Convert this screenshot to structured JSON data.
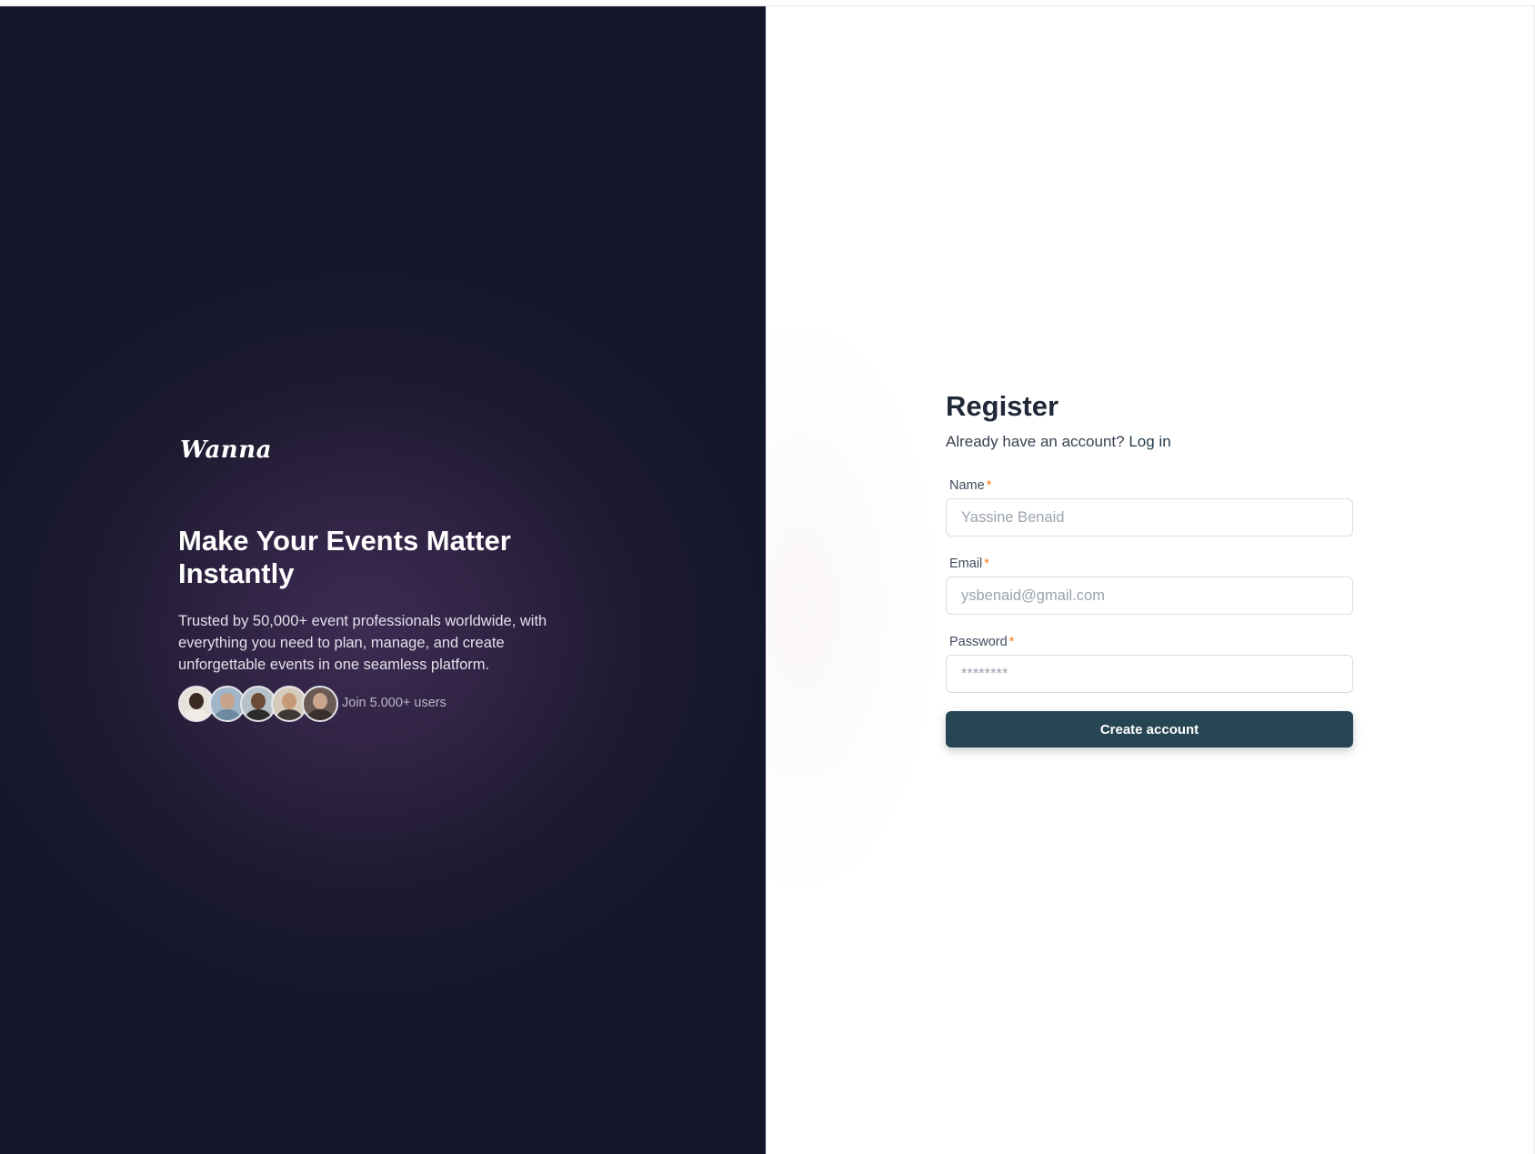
{
  "brand": {
    "logo_text": "Wanna"
  },
  "hero": {
    "headline": "Make Your Events Matter Instantly",
    "description": "Trusted by 50,000+ event professionals worldwide, with everything you need to plan, manage, and create unforgettable events in one seamless platform.",
    "join_text": "Join 5.000+ users",
    "avatars": [
      {
        "name": "user-avatar-1",
        "bg": "#e8e2dc",
        "head": "#3a2a22",
        "body": "#f1ece6"
      },
      {
        "name": "user-avatar-2",
        "bg": "#9fb6c8",
        "head": "#c7a489",
        "body": "#6d8aa0"
      },
      {
        "name": "user-avatar-3",
        "bg": "#b7c1c9",
        "head": "#6b4a36",
        "body": "#2b2b2b"
      },
      {
        "name": "user-avatar-4",
        "bg": "#d6cbbb",
        "head": "#c69a78",
        "body": "#3d3a36"
      },
      {
        "name": "user-avatar-5",
        "bg": "#6a5a56",
        "head": "#caa48d",
        "body": "#3b2f2d"
      }
    ]
  },
  "form": {
    "title": "Register",
    "login_prompt": "Already have an account?",
    "login_link": "Log in",
    "name_label": "Name",
    "name_placeholder": "Yassine Benaid",
    "email_label": "Email",
    "email_placeholder": "ysbenaid@gmail.com",
    "password_label": "Password",
    "password_placeholder": "********",
    "required_marker": "*",
    "submit_label": "Create account"
  },
  "colors": {
    "primary_button": "#264653",
    "required": "#f97316",
    "left_panel_dark": "#131729",
    "left_panel_glow": "#3d2b52"
  }
}
